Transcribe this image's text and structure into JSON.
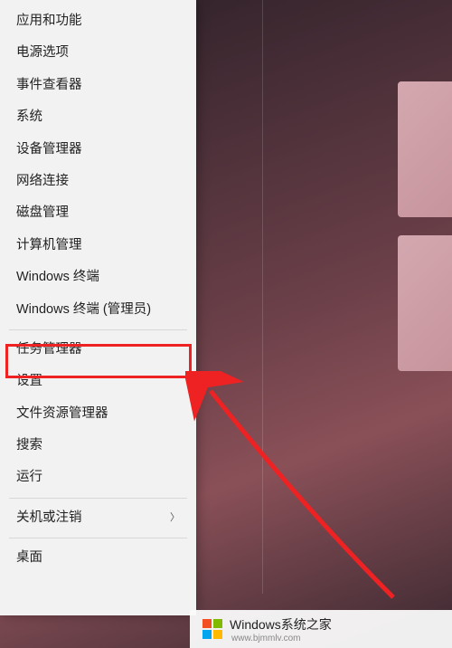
{
  "menu": {
    "items": [
      {
        "label": "应用和功能",
        "submenu": false
      },
      {
        "label": "电源选项",
        "submenu": false
      },
      {
        "label": "事件查看器",
        "submenu": false
      },
      {
        "label": "系统",
        "submenu": false
      },
      {
        "label": "设备管理器",
        "submenu": false
      },
      {
        "label": "网络连接",
        "submenu": false
      },
      {
        "label": "磁盘管理",
        "submenu": false
      },
      {
        "label": "计算机管理",
        "submenu": false
      },
      {
        "label": "Windows 终端",
        "submenu": false
      },
      {
        "label": "Windows 终端 (管理员)",
        "submenu": false,
        "highlighted": true
      },
      {
        "label": "任务管理器",
        "submenu": false
      },
      {
        "label": "设置",
        "submenu": false
      },
      {
        "label": "文件资源管理器",
        "submenu": false
      },
      {
        "label": "搜索",
        "submenu": false
      },
      {
        "label": "运行",
        "submenu": false
      },
      {
        "label": "关机或注销",
        "submenu": true
      },
      {
        "label": "桌面",
        "submenu": false
      }
    ],
    "separators_after": [
      9,
      14,
      15
    ]
  },
  "watermark": {
    "title": "Windows系统之家",
    "subtitle": "www.bjmmlv.com"
  },
  "annotation": {
    "highlight_color": "#ee2222",
    "arrow_color": "#ee2222"
  }
}
